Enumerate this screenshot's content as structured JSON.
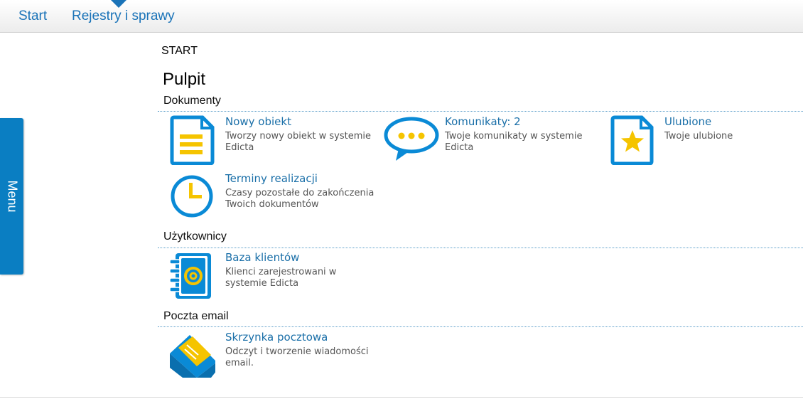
{
  "nav": {
    "start": "Start",
    "rejestry": "Rejestry i sprawy"
  },
  "menu": {
    "label": "Menu"
  },
  "breadcrumb": "START",
  "page_title": "Pulpit",
  "sections": {
    "dokumenty": {
      "title": "Dokumenty",
      "tiles": [
        {
          "title": "Nowy obiekt",
          "desc1": "Tworzy nowy obiekt w systemie",
          "desc2": "Edicta",
          "icon": "document-icon"
        },
        {
          "title": "Komunikaty: 2",
          "desc1": "Twoje komunikaty w systemie",
          "desc2": "Edicta",
          "icon": "chat-bubble-icon"
        },
        {
          "title": "Ulubione",
          "desc1": "Twoje ulubione",
          "desc2": "",
          "icon": "star-document-icon"
        },
        {
          "title": "Terminy realizacji",
          "desc1": "Czasy pozostałe do zakończenia",
          "desc2": "Twoich dokumentów",
          "icon": "clock-icon"
        }
      ]
    },
    "uzytkownicy": {
      "title": "Użytkownicy",
      "tiles": [
        {
          "title": "Baza klientów",
          "desc1": "Klienci zarejestrowani w",
          "desc2": "systemie Edicta",
          "icon": "address-book-icon"
        }
      ]
    },
    "poczta": {
      "title": "Poczta email",
      "tiles": [
        {
          "title": "Skrzynka pocztowa",
          "desc1": "Odczyt i tworzenie wiadomości",
          "desc2": "email.",
          "icon": "envelope-icon"
        }
      ]
    }
  },
  "colors": {
    "brand_blue": "#0a7ec2",
    "link_blue": "#1a6fa8",
    "icon_yellow": "#f5c400"
  }
}
